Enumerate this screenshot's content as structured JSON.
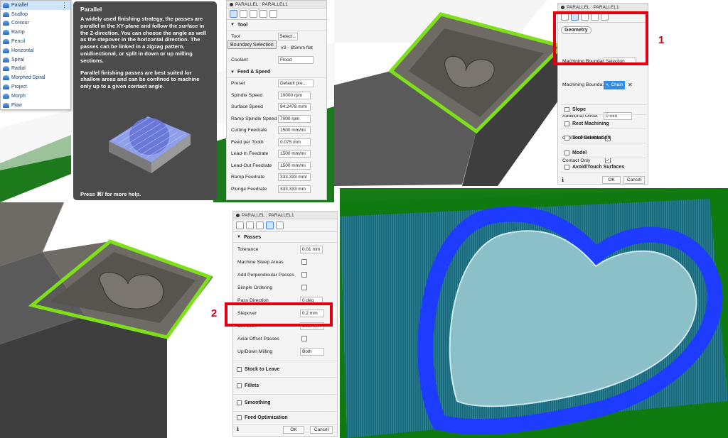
{
  "menu": {
    "items": [
      {
        "label": "Parallel",
        "selected": true
      },
      {
        "label": "Scallop"
      },
      {
        "label": "Contour"
      },
      {
        "label": "Ramp"
      },
      {
        "label": "Pencil"
      },
      {
        "label": "Horizontal"
      },
      {
        "label": "Spiral"
      },
      {
        "label": "Radial"
      },
      {
        "label": "Morphed Spiral"
      },
      {
        "label": "Project"
      },
      {
        "label": "Morph"
      },
      {
        "label": "Flow"
      }
    ],
    "more_glyph": "⋮"
  },
  "tooltip": {
    "title": "Parallel",
    "para1": "A widely used finishing strategy, the passes are parallel in the XY-plane and follow the surface in the Z-direction. You can choose the angle as well as the stepover in the horizontal direction. The passes can be linked in a zigzag pattern, unidirectional, or split in down or up milling sections.",
    "para2": "Parallel finishing passes are best suited for shallow areas and can be confined to machine only up to a given contact angle.",
    "help": "Press ⌘/ for more help."
  },
  "dialog_tool": {
    "title": "PARALLEL : PARALLEL1",
    "tool_section": "Tool",
    "tool_label": "Tool",
    "tool_button": "Select...",
    "tool_desc": "#3 - Ø3mm flat",
    "boundary_popup": "Boundary Selection",
    "coolant_label": "Coolant",
    "coolant_value": "Flood",
    "feed_section": "Feed & Speed",
    "rows": [
      {
        "label": "Preset",
        "value": "Default pre..."
      },
      {
        "label": "Spindle Speed",
        "value": "10000 rpm"
      },
      {
        "label": "Surface Speed",
        "value": "94.2478 m/m"
      },
      {
        "label": "Ramp Spindle Speed",
        "value": "7000 rpm"
      },
      {
        "label": "Cutting Feedrate",
        "value": "1500 mm/mi"
      },
      {
        "label": "Feed per Tooth",
        "value": "0.075 mm"
      },
      {
        "label": "Lead-In Feedrate",
        "value": "1500 mm/mi"
      },
      {
        "label": "Lead-Out Feedrate",
        "value": "1500 mm/mi"
      },
      {
        "label": "Ramp Feedrate",
        "value": "333.333 mm/"
      },
      {
        "label": "Plunge Feedrate",
        "value": "333.333 mm"
      }
    ]
  },
  "dialog_geometry": {
    "title": "PARALLEL : PARALLEL1",
    "tooltip": "Geometry",
    "boundary_label": "Machining Boundary",
    "boundary_value": "Selection",
    "boundary2_label": "Machining Bounda...",
    "chain_label": "Chain",
    "offset_label": "Additional Offset",
    "offset_value": "0 mm",
    "contact_bound_label": "Contact Point Bour...",
    "contact_only_label": "Contact Only",
    "sections": [
      "Slope",
      "Rest Machining",
      "Tool Orientation",
      "Model",
      "Avoid/Touch Surfaces"
    ],
    "ok": "OK",
    "cancel": "Cancel",
    "callout": "1"
  },
  "dialog_passes": {
    "title": "PARALLEL : PARALLEL1",
    "passes_section": "Passes",
    "tolerance_label": "Tolerance",
    "tolerance_value": "0.01 mm",
    "steep_label": "Machine Steep Areas",
    "perp_label": "Add Perpendicular Passes",
    "simple_label": "Simple Ordering",
    "pass_dir_label": "Pass Direction",
    "pass_dir_value": "0 deg",
    "stepover_label": "Stepover",
    "stepover_value": "0.2 mm",
    "direction_label": "Direction",
    "direction_value": "Both W...",
    "axial_label": "Axial Offset Passes",
    "updown_label": "Up/Down Milling",
    "updown_value": "Both",
    "sections": [
      "Stock to Leave",
      "Fillets",
      "Smoothing",
      "Feed Optimization"
    ],
    "ok": "OK",
    "cancel": "Cancel",
    "callout": "2"
  },
  "colors": {
    "highlight": "#7ee01a",
    "callout": "#e0000f",
    "toolpath": "#1e3cff",
    "tooltip_bg": "#4b4b4b"
  }
}
